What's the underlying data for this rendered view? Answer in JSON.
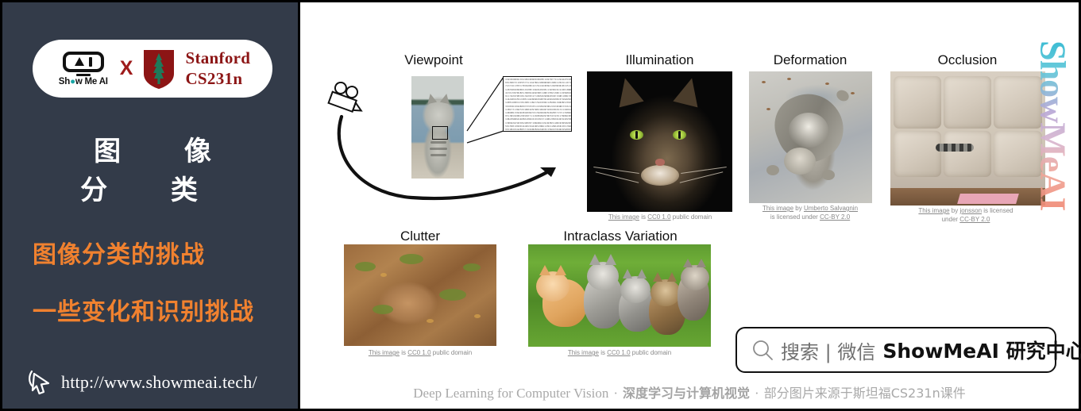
{
  "left": {
    "badge": {
      "brand_logo_text": "Show Me AI",
      "brand_logo_icon": "ai-monitor-icon",
      "cross_label": "X",
      "partner_icon": "stanford-tree-shield-icon",
      "partner_line1": "Stanford",
      "partner_line2": "CS231n"
    },
    "title": "图 像 分 类",
    "subtitle_1": "图像分类的挑战",
    "subtitle_2": "一些变化和识别挑战",
    "cursor_icon": "mouse-pointer-icon",
    "url": "http://www.showmeai.tech/",
    "colors": {
      "background": "#333b49",
      "accent_orange": "#f0812f",
      "title_white": "#ffffff",
      "stanford_red": "#8C1515"
    }
  },
  "right": {
    "sections": [
      {
        "id": "viewpoint",
        "title": "Viewpoint",
        "caption": ""
      },
      {
        "id": "illumination",
        "title": "Illumination",
        "caption_prefix": "This image",
        "caption_mid": " is ",
        "caption_link": "CC0 1.0",
        "caption_suffix": " public domain"
      },
      {
        "id": "deformation",
        "title": "Deformation",
        "caption_line1_a": "This image",
        "caption_line1_b": " by ",
        "caption_line1_c": "Umberto Salvagnin",
        "caption_line2_a": "is licensed under ",
        "caption_line2_b": "CC-BY 2.0"
      },
      {
        "id": "occlusion",
        "title": "Occlusion",
        "caption_line1_a": "This image",
        "caption_line1_b": " by ",
        "caption_line1_c": "jonsson",
        "caption_line1_d": " is licensed",
        "caption_line2_a": "under ",
        "caption_line2_b": "CC-BY 2.0"
      },
      {
        "id": "clutter",
        "title": "Clutter",
        "caption_prefix": "This image",
        "caption_mid": " is ",
        "caption_link": "CC0 1.0",
        "caption_suffix": " public domain"
      },
      {
        "id": "intraclass",
        "title": "Intraclass Variation",
        "caption_prefix": "This image",
        "caption_mid": " is ",
        "caption_link": "CC0 1.0",
        "caption_suffix": " public domain"
      }
    ],
    "camera_icon": "video-camera-icon",
    "arrow_icon": "curved-arrow-icon",
    "search_box": {
      "icon": "search-icon",
      "label": "搜索 | 微信",
      "brand": "ShowMeAI 研究中心"
    },
    "watermark": "ShowMeAI",
    "footer": {
      "en": "Deep Learning for Computer Vision",
      "sep": "·",
      "cn_bold": "深度学习与计算机视觉",
      "cn": "部分图片来源于斯坦福CS231n课件"
    }
  }
}
